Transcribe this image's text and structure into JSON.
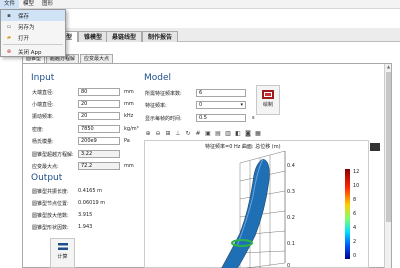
{
  "menu": {
    "items": [
      {
        "label": "文件"
      },
      {
        "label": "模型"
      },
      {
        "label": "图形"
      }
    ]
  },
  "file_menu": {
    "items": [
      {
        "label": "保存",
        "icon": "save-icon"
      },
      {
        "label": "另存为",
        "icon": "save-as-icon"
      },
      {
        "label": "打开",
        "icon": "open-folder-icon"
      },
      {
        "label": "关闭 App",
        "icon": "close-app-icon"
      }
    ]
  },
  "tabs": [
    {
      "label": "型"
    },
    {
      "label": "锥模型"
    },
    {
      "label": "悬链线型"
    },
    {
      "label": "制作报告"
    }
  ],
  "subtabs": [
    {
      "label": "圆锥型"
    },
    {
      "label": "超越方程解"
    },
    {
      "label": "应变最大点"
    }
  ],
  "input": {
    "heading": "Input",
    "rows": [
      {
        "label": "大端直径:",
        "value": "80",
        "unit": "mm"
      },
      {
        "label": "小端直径:",
        "value": "20",
        "unit": "mm"
      },
      {
        "label": "振动频率:",
        "value": "20",
        "unit": "kHz"
      },
      {
        "label": "密度:",
        "value": "7850",
        "unit": "kg/m³"
      },
      {
        "label": "杨氏模量:",
        "value": "200e9",
        "unit": "Pa"
      },
      {
        "label": "圆锥型超越方程解:",
        "value": "3.22",
        "unit": ""
      },
      {
        "label": "应变最大点:",
        "value": "72.2",
        "unit": "mm"
      }
    ]
  },
  "output": {
    "heading": "Output",
    "rows": [
      {
        "label": "圆锥型共振长度:",
        "value": "0.4165 m"
      },
      {
        "label": "圆锥型节点位置:",
        "value": "0.06019 m"
      },
      {
        "label": "圆锥型放大倍数:",
        "value": "3.915"
      },
      {
        "label": "圆锥型形状因数:",
        "value": "1.943"
      }
    ]
  },
  "compute_button": {
    "label": "计算"
  },
  "model": {
    "heading": "Model",
    "rows": [
      {
        "label": "所需特征频率数:",
        "value": "6"
      },
      {
        "label": "特征频率:",
        "value": "0"
      },
      {
        "label": "显示每帧的时间:",
        "value": "0.5",
        "unit": "s"
      }
    ],
    "draw_button": {
      "label": "绘制"
    }
  },
  "plot": {
    "title": "特征频率=0 Hz  曲面: 总位移 (m)",
    "z_ticks": [
      "0.4",
      "0.3",
      "0.2",
      "0.1",
      "0"
    ],
    "colorbar_ticks": [
      "12",
      "10",
      "8",
      "6",
      "4",
      "2",
      "0"
    ],
    "colors": {
      "tube": "#1f6fb5",
      "ring": "#2bb34a",
      "colorbar_top": "#8b0000",
      "colorbar_bottom": "#00008b"
    }
  },
  "toolbar": {
    "icons": [
      "zoom-in-icon",
      "zoom-out-icon",
      "zoom-extents-icon",
      "axis-icon",
      "orbit-icon",
      "grid-icon",
      "view-xy-icon",
      "view-yz-icon",
      "view-zx-icon",
      "view-3d-icon",
      "camera-icon",
      "image-icon"
    ]
  }
}
